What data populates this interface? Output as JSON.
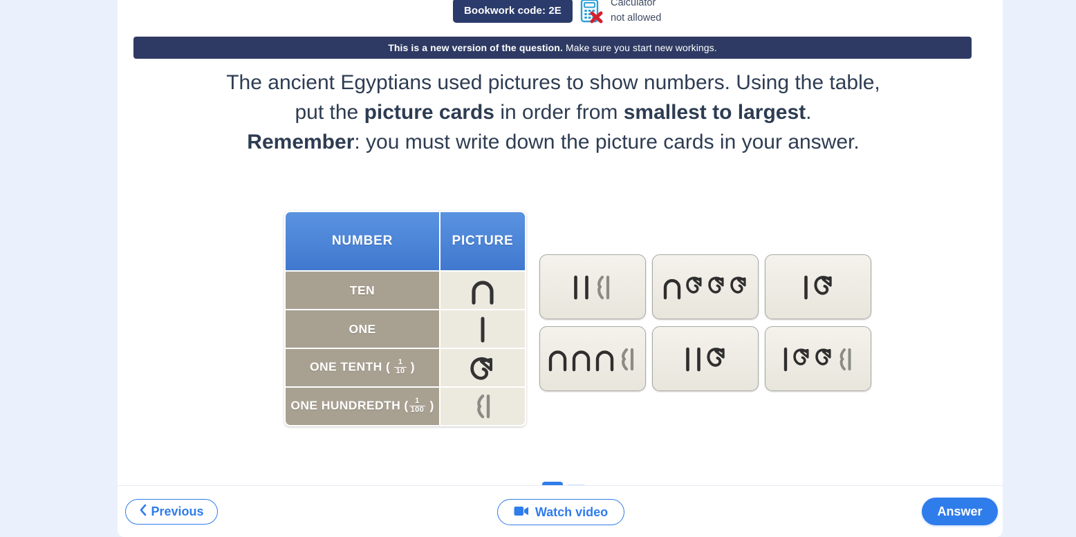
{
  "header": {
    "bookwork_label": "Bookwork code: 2E",
    "calculator_line1": "Calculator",
    "calculator_line2": "not allowed",
    "calculator_icon": "calculator-not-allowed-icon"
  },
  "notice": {
    "bold": "This is a new version of the question.",
    "rest": "Make sure you start new workings."
  },
  "question": {
    "line1_a": "The ancient Egyptians used pictures to show numbers. Using the table,",
    "line2_a": "put the ",
    "line2_b": "picture cards",
    "line2_c": " in order from ",
    "line2_d": "smallest to largest",
    "line2_e": ".",
    "line3_a": "Remember",
    "line3_b": ": you must write down the picture cards in your answer."
  },
  "table": {
    "headers": [
      "NUMBER",
      "PICTURE"
    ],
    "rows": [
      {
        "label": "TEN",
        "fraction": null,
        "glyph": "ten-arch-glyph"
      },
      {
        "label": "ONE",
        "fraction": null,
        "glyph": "one-stroke-glyph"
      },
      {
        "label": "ONE TENTH",
        "fraction": {
          "num": "1",
          "den": "10"
        },
        "glyph": "one-tenth-spiral-glyph"
      },
      {
        "label": "ONE HUNDREDTH",
        "fraction": {
          "num": "1",
          "den": "100"
        },
        "glyph": "one-hundredth-glyph"
      }
    ]
  },
  "cards": [
    {
      "id": "card-1",
      "glyphs": [
        "one",
        "one",
        "hundredth"
      ],
      "reading": "| | ⟨|"
    },
    {
      "id": "card-2",
      "glyphs": [
        "ten",
        "tenth",
        "tenth",
        "tenth"
      ],
      "reading": "∩ Ꮇ Ꮇ Ꮇ"
    },
    {
      "id": "card-3",
      "glyphs": [
        "one",
        "tenth"
      ],
      "reading": "| Ꮇ"
    },
    {
      "id": "card-4",
      "glyphs": [
        "ten",
        "ten",
        "ten",
        "hundredth"
      ],
      "reading": "∩ ∩ ∩ ⟨|"
    },
    {
      "id": "card-5",
      "glyphs": [
        "one",
        "one",
        "tenth"
      ],
      "reading": "| | Ꮇ"
    },
    {
      "id": "card-6",
      "glyphs": [
        "one",
        "tenth",
        "tenth",
        "hundredth"
      ],
      "reading": "| Ꮇ Ꮇ ⟨|"
    }
  ],
  "footer": {
    "previous_label": "Previous",
    "watch_video_label": "Watch video",
    "answer_label": "Answer",
    "previous_icon": "chevron-left-icon",
    "video_icon": "video-camera-icon"
  },
  "colors": {
    "page_background": "#eaf1fc",
    "panel_background": "#ffffff",
    "notice_background": "#2e3a63",
    "bookwork_background": "#2b3b6b",
    "table_header": "#4a86d8",
    "table_row_label": "#a8a091",
    "table_row_picture": "#ece9df",
    "accent_blue": "#2f7ceb",
    "question_text": "#2d3c52",
    "card_border": "#a9a9a4"
  },
  "scrollbar": {
    "down_arrow_icon": "chevron-down-icon"
  }
}
